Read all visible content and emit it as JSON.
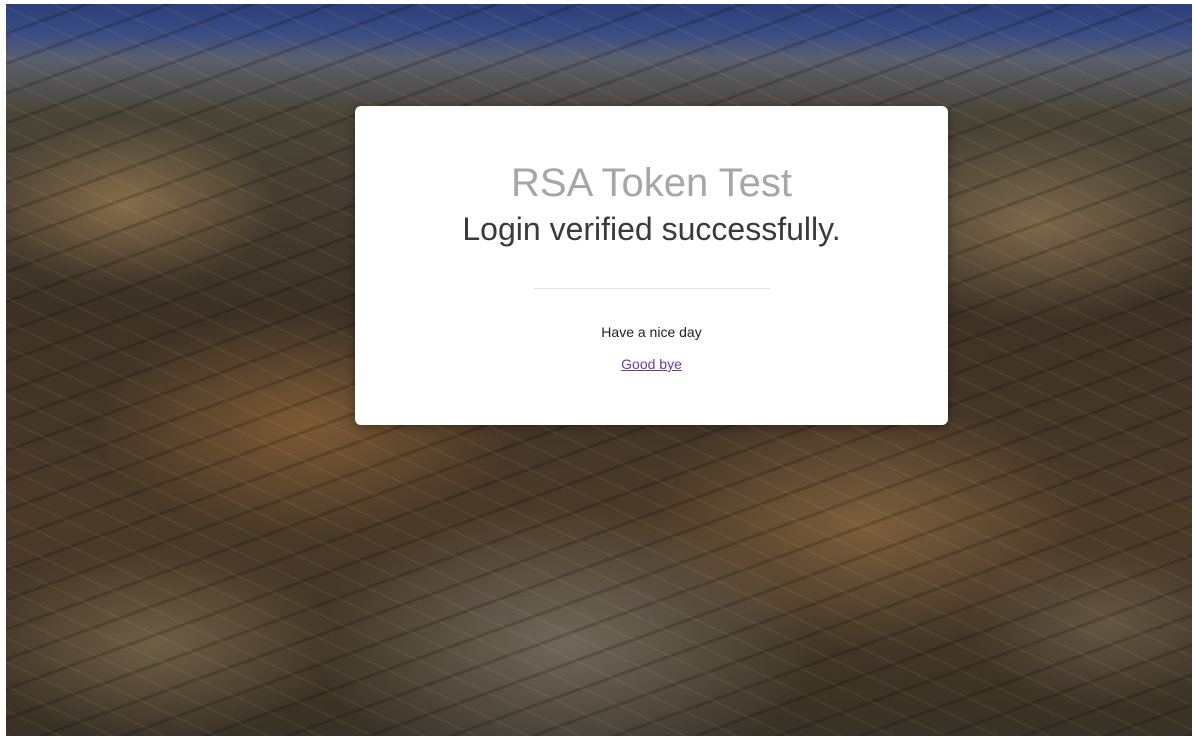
{
  "card": {
    "title": "RSA Token Test",
    "subtitle": "Login verified successfully.",
    "message": "Have a nice day",
    "link_label": "Good bye"
  },
  "colors": {
    "title": "#a6a6a6",
    "subtitle": "#3a3a3a",
    "link": "#6a3d9a",
    "card_background": "#ffffff"
  }
}
